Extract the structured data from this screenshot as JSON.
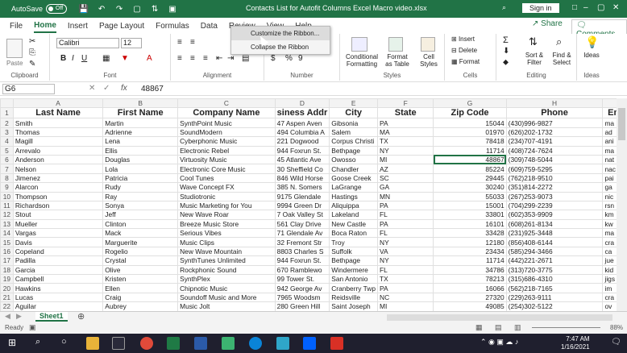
{
  "titlebar": {
    "autosave_label": "AutoSave",
    "autosave_state": "Off",
    "doc_title": "Contacts List for Autofit Columns Excel Macro video.xlsx",
    "sign_in": "Sign in"
  },
  "tabs": [
    "File",
    "Home",
    "Insert",
    "Page Layout",
    "Formulas",
    "Data",
    "Review",
    "View",
    "Help"
  ],
  "share_label": "Share",
  "comments_label": "Comments",
  "ribbon": {
    "clipboard_label": "Clipboard",
    "paste_label": "Paste",
    "font_label": "Font",
    "font_name": "Calibri",
    "font_size": "12",
    "alignment_label": "Alignment",
    "number_label": "Number",
    "styles_label": "Styles",
    "conditional": "Conditional Formatting",
    "format_table": "Format as Table",
    "cell_styles": "Cell Styles",
    "cells_label": "Cells",
    "insert": "Insert",
    "delete": "Delete",
    "format": "Format",
    "editing_label": "Editing",
    "sort_filter": "Sort & Filter",
    "find_select": "Find & Select",
    "ideas": "Ideas",
    "ideas_group": "Ideas"
  },
  "context_menu": {
    "item1": "Customize the Ribbon...",
    "item2": "Collapse the Ribbon"
  },
  "formula_bar": {
    "name_box": "G6",
    "fx": "fx",
    "value": "48867"
  },
  "columns": [
    "A",
    "B",
    "C",
    "D",
    "E",
    "F",
    "G",
    "H"
  ],
  "headers": [
    "Last Name",
    "First Name",
    "Company Name",
    "siness Addr",
    "City",
    "State",
    "Zip Code",
    "Phone",
    "Em"
  ],
  "rows": [
    [
      "Smith",
      "Martin",
      "SynthPoint Music",
      "47 Aspen Aven",
      "Gibsonia",
      "PA",
      "15044",
      "(430)996-9827",
      "ma"
    ],
    [
      "Thomas",
      "Adrienne",
      "SoundModern",
      "494 Columbia A",
      "Salem",
      "MA",
      "01970",
      "(626)202-1732",
      "ad"
    ],
    [
      "Magill",
      "Lena",
      "Cyberphonic Music",
      "221 Dogwood",
      "Corpus Christi",
      "TX",
      "78418",
      "(234)707-4191",
      "ani"
    ],
    [
      "Arrevalo",
      "Ellis",
      "Electronic Rebel",
      "944 Foxrun St.",
      "Bethpage",
      "NY",
      "11714",
      "(408)724-7624",
      "ma"
    ],
    [
      "Anderson",
      "Douglas",
      "Virtuosity Music",
      "45 Atlantic Ave",
      "Owosso",
      "MI",
      "48867",
      "(309)748-5044",
      "nat"
    ],
    [
      "Nelson",
      "Lola",
      "Electronic Core Music",
      "30 Sheffield Co",
      "Chandler",
      "AZ",
      "85224",
      "(609)759-5295",
      "nac"
    ],
    [
      "Jimenez",
      "Patricia",
      "Cool Tunes",
      "846 Wild Horse",
      "Goose Creek",
      "SC",
      "29445",
      "(762)218-9510",
      "pai"
    ],
    [
      "Alarcon",
      "Rudy",
      "Wave Concept FX",
      "385 N. Somers",
      "LaGrange",
      "GA",
      "30240",
      "(351)814-2272",
      "ga"
    ],
    [
      "Thompson",
      "Ray",
      "Studiotronic",
      "9175 Glendale",
      "Hastings",
      "MN",
      "55033",
      "(267)253-9073",
      "nic"
    ],
    [
      "Richardson",
      "Sonya",
      "Music Marketing for You",
      "9994 Green Dr",
      "Aliquippa",
      "PA",
      "15001",
      "(704)299-2239",
      "rsn"
    ],
    [
      "Stout",
      "Jeff",
      "New Wave Roar",
      "7 Oak Valley St",
      "Lakeland",
      "FL",
      "33801",
      "(602)353-9909",
      "km"
    ],
    [
      "Mueller",
      "Clinton",
      "Breeze Music Store",
      "561 Clay Drive",
      "New Castle",
      "PA",
      "16101",
      "(608)261-8134",
      "kw"
    ],
    [
      "Vargas",
      "Mack",
      "Serious Vibes",
      "71 Glendale Av",
      "Boca Raton",
      "FL",
      "33428",
      "(231)925-3448",
      "ma"
    ],
    [
      "Davis",
      "Marguerite",
      "Music Clips",
      "32 Fremont Str",
      "Troy",
      "NY",
      "12180",
      "(856)408-6144",
      "cra"
    ],
    [
      "Copeland",
      "Rogelio",
      "New Wave Mountain",
      "8803 Charles S",
      "Suffolk",
      "VA",
      "23434",
      "(585)294-3466",
      "ca"
    ],
    [
      "Padilla",
      "Crystal",
      "SynthTunes Unlimited",
      "944 Foxrun St.",
      "Bethpage",
      "NY",
      "11714",
      "(442)221-2671",
      "jue"
    ],
    [
      "Garcia",
      "Olive",
      "Rockphonic Sound",
      "670 Ramblewo",
      "Windermere",
      "FL",
      "34786",
      "(313)720-3775",
      "kid"
    ],
    [
      "Campbell",
      "Kristen",
      "SynthPlex",
      "99 Tower St.",
      "San Antonio",
      "TX",
      "78213",
      "(315)686-4310",
      "jigs"
    ],
    [
      "Hawkins",
      "Ellen",
      "Chipnotic Music",
      "942 George Av",
      "Cranberry Twp",
      "PA",
      "16066",
      "(562)218-7165",
      "im"
    ],
    [
      "Lucas",
      "Craig",
      "Soundoff Music and More",
      "7965 Woodsm",
      "Reidsville",
      "NC",
      "27320",
      "(229)263-9111",
      "cra"
    ],
    [
      "Aguilar",
      "Aubrey",
      "Music Jolt",
      "280 Green Hill",
      "Saint Joseph",
      "MI",
      "49085",
      "(254)302-5122",
      "ov"
    ]
  ],
  "row_numbers": [
    "1",
    "2",
    "3",
    "4",
    "5",
    "6",
    "7",
    "8",
    "9",
    "10",
    "11",
    "12",
    "13",
    "14",
    "15",
    "16",
    "17",
    "18",
    "19",
    "20",
    "21",
    "22",
    "23"
  ],
  "sheet_tab": "Sheet1",
  "status": {
    "ready": "Ready",
    "zoom": "88%"
  },
  "clock": {
    "time": "7:47 AM",
    "date": "1/16/2021"
  }
}
